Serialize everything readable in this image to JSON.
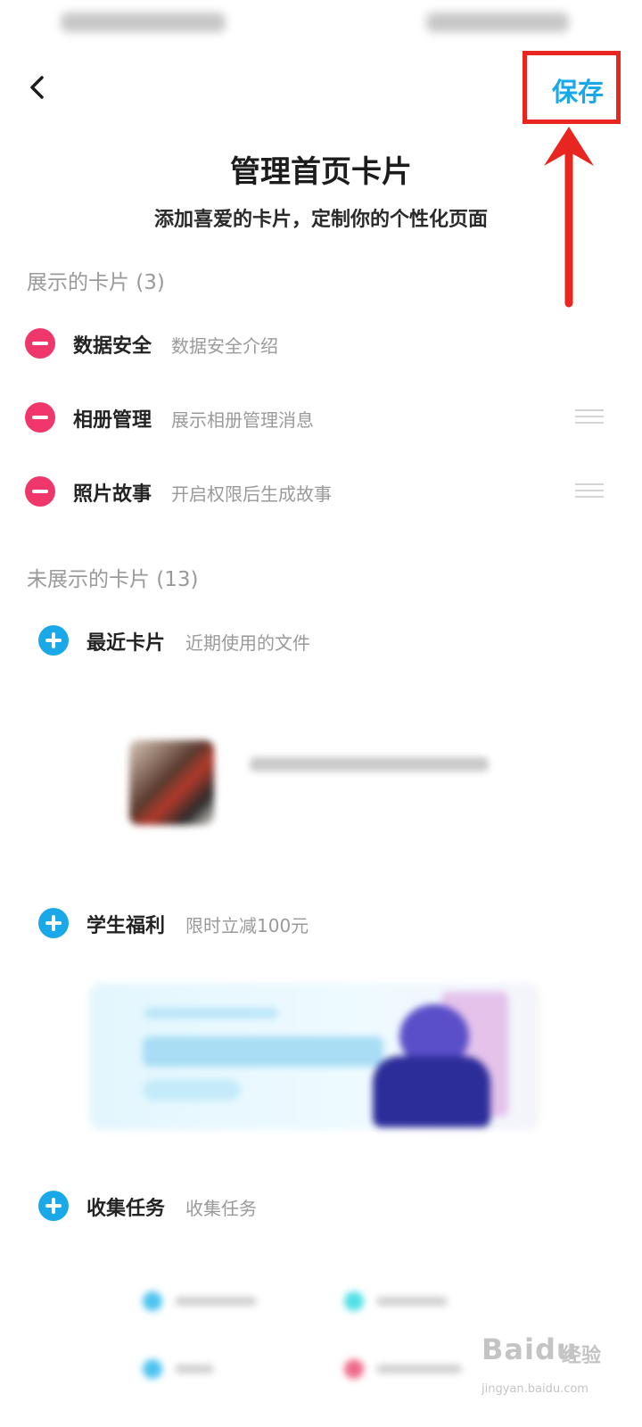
{
  "header": {
    "back_icon": "chevron-left-icon",
    "save_label": "保存",
    "title": "管理首页卡片",
    "subtitle": "添加喜爱的卡片，定制你的个性化页面"
  },
  "colors": {
    "accent": "#1aa8e8",
    "remove": "#f0376b",
    "annotation": "#e8251e"
  },
  "shown_section": {
    "header": "展示的卡片 (3)",
    "cards": [
      {
        "name": "数据安全",
        "desc": "数据安全介绍"
      },
      {
        "name": "相册管理",
        "desc": "展示相册管理消息"
      },
      {
        "name": "照片故事",
        "desc": "开启权限后生成故事"
      }
    ]
  },
  "hidden_section": {
    "header": "未展示的卡片 (13)",
    "cards": [
      {
        "name": "最近卡片",
        "desc": "近期使用的文件"
      },
      {
        "name": "学生福利",
        "desc": "限时立减100元"
      },
      {
        "name": "收集任务",
        "desc": "收集任务"
      }
    ]
  },
  "watermark": {
    "logo": "Baidu",
    "suffix": "经验",
    "url": "jingyan.baidu.com"
  }
}
